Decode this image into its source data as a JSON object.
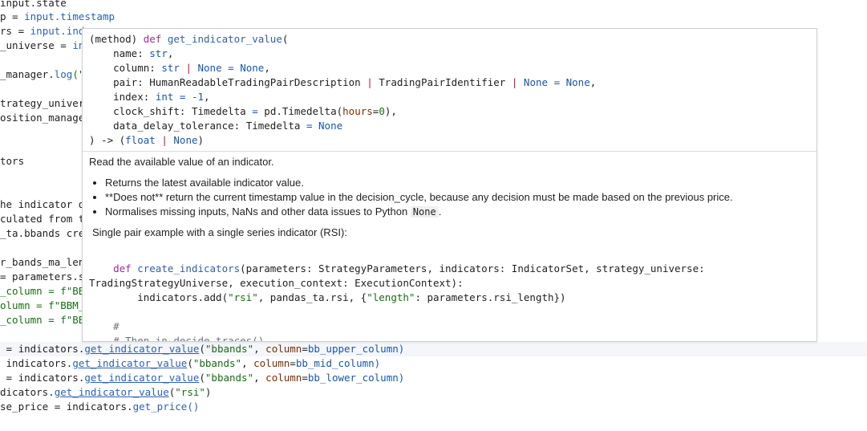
{
  "editor": {
    "lines": [
      {
        "a": "input.state"
      },
      {
        "a": "p = ",
        "b": "input.timestamp"
      },
      {
        "a": "rs = ",
        "b": "input.ind"
      },
      {
        "a": "_universe = ",
        "b": "in"
      },
      {
        "a": "_manager.",
        "f": "log",
        "c": "(\""
      },
      {
        "a": "trategy_univer"
      },
      {
        "a": "osition_manage"
      },
      {
        "a": "tors"
      },
      {
        "a": "he indicator d"
      },
      {
        "a": "culated from t"
      },
      {
        "a": "_ta.bbands cre"
      },
      {
        "a": "r_bands_ma_len"
      },
      {
        "a": "= parameters.s"
      },
      {
        "a": "_column = f\"BB"
      },
      {
        "a": "olumn = f\"BBM_"
      },
      {
        "a": "_column = f\"BB"
      }
    ],
    "calls": [
      {
        "prefix": " = indicators.",
        "method": "get_indicator_value",
        "arg": "\"bbands\"",
        "kw": "column",
        "val": "bb_upper_column"
      },
      {
        "prefix": " indicators.",
        "method": "get_indicator_value",
        "arg": "\"bbands\"",
        "kw": "column",
        "val": "bb_mid_column"
      },
      {
        "prefix": " = indicators.",
        "method": "get_indicator_value",
        "arg": "\"bbands\"",
        "kw": "column",
        "val": "bb_lower_column"
      },
      {
        "prefix": "dicators.",
        "method": "get_indicator_value",
        "arg": "\"rsi\""
      },
      {
        "prefix": "se_price = indicators.",
        "method": "get_price",
        "tail": "()"
      }
    ]
  },
  "popup": {
    "sig_head_kind": "(method)",
    "sig_head_kw": "def",
    "sig_head_name": "get_indicator_value",
    "params": {
      "name": "name",
      "name_type": "str",
      "column": "column",
      "column_type": "str",
      "column_none": "None",
      "column_default": "None",
      "pair": "pair",
      "pair_type1": "HumanReadableTradingPairDescription",
      "pair_type2": "TradingPairIdentifier",
      "pair_none": "None",
      "pair_default": "None",
      "index": "index",
      "index_type": "int",
      "index_default": "-1",
      "clock": "clock_shift",
      "clock_type": "Timedelta",
      "clock_default_fn": "pd.Timedelta",
      "clock_kw": "hours",
      "clock_num": "0",
      "delay": "data_delay_tolerance",
      "delay_type": "Timedelta",
      "delay_default": "None"
    },
    "ret_float": "float",
    "ret_none": "None",
    "summary": "Read the available value of an indicator.",
    "bullets": [
      "Returns the latest available indicator value.",
      "**Does not** return the current timestamp value in the decision_cycle, because any decision must be made based on the previous price.",
      "Normalises missing inputs, NaNs and other data issues to Python "
    ],
    "bullet3_code": "None",
    "bullet3_tail": ".",
    "example_title": "Single pair example with a single series indicator (RSI):",
    "code": {
      "def_kw": "def",
      "def_name": "create_indicators",
      "def_args": "(parameters: StrategyParameters, indicators: IndicatorSet, strategy_universe:",
      "cont": "TradingStrategyUniverse, execution_context: ExecutionContext):",
      "body_a": "indicators.add(",
      "body_s1": "\"rsi\"",
      "body_b": ", pandas_ta.rsi, {",
      "body_s2": "\"length\"",
      "body_c": ": parameters.rsi_length})",
      "comment1": "#",
      "comment2": "# Then in decide_traces()"
    }
  }
}
